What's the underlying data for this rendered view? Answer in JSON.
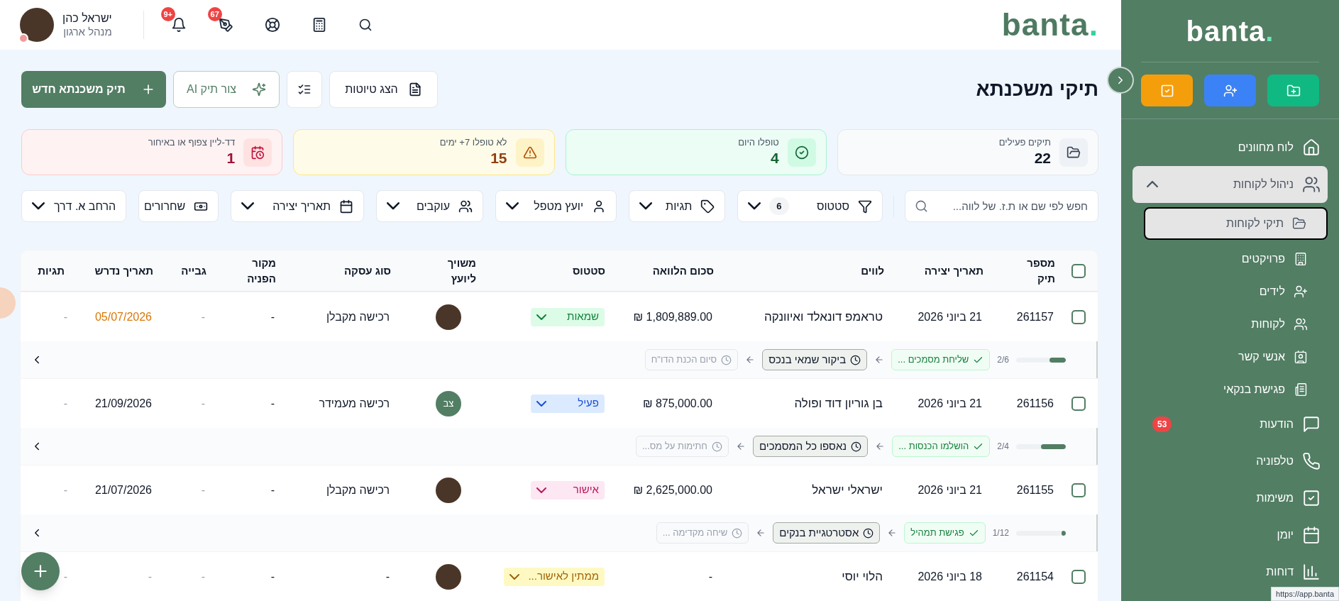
{
  "topbar": {
    "logo": "banta.",
    "notifications_badge": "+9",
    "signatures_badge": "67",
    "user": {
      "name": "ישראל כהן",
      "role": "מנהל ארגון"
    }
  },
  "page": {
    "title": "תיקי משכנתא",
    "drafts_button": "הצג טיוטות",
    "ai_button": "צור תיק AI",
    "new_button": "תיק משכנתא חדש"
  },
  "stats": [
    {
      "label": "תיקים פעילים",
      "value": "22",
      "kind": "neutral"
    },
    {
      "label": "טופלו היום",
      "value": "4",
      "kind": "success"
    },
    {
      "label": "לא טופלו 7+ ימים",
      "value": "15",
      "kind": "warning"
    },
    {
      "label": "דד-ליין צפוף או באיחור",
      "value": "1",
      "kind": "danger"
    }
  ],
  "filters": {
    "search": {
      "placeholder": "חפש לפי שם או ת.ז. של לווה..."
    },
    "chips": [
      {
        "label": "סטטוס",
        "count": "6",
        "kind": "status"
      },
      {
        "label": "תגיות",
        "kind": "tags"
      },
      {
        "label": "יועץ מטפל",
        "kind": "advisor"
      },
      {
        "label": "עוקבים",
        "kind": "followers"
      },
      {
        "label": "תאריך יצירה",
        "kind": "date"
      },
      {
        "label": "שחרורים",
        "kind": "releases"
      },
      {
        "label": "הרחב א. דרך",
        "kind": "expand"
      }
    ]
  },
  "table": {
    "select_all": {
      "checked": false
    },
    "columns": [
      "מספר תיק",
      "תאריך יצירה",
      "לווים",
      "סכום הלוואה",
      "סטטוס",
      "משויך ליועץ",
      "סוג עסקה",
      "מקור הפניה",
      "גבייה",
      "תאריך נדרש",
      "תגיות"
    ],
    "rows": [
      {
        "checked": false,
        "file_number": "261157",
        "created": "21 ביוני 2026",
        "borrower": "טראמפ דונאלד ואיוונקה",
        "amount": "1,809,889.00 ₪",
        "status": {
          "label": "שמאות",
          "kind": "green"
        },
        "advisor": {
          "kind": "photo"
        },
        "deal_type": "רכישה מקבלן",
        "source": "-",
        "collection": "-",
        "required_date": "05/07/2026",
        "overdue": true,
        "tags": "-",
        "pipeline": {
          "level": 0.33,
          "progress": "2/6",
          "steps": [
            {
              "label": "שליחת מסמכים ...",
              "kind": "done"
            },
            {
              "label": "ביקור שמאי בנכס",
              "kind": "current"
            },
            {
              "label": "סיום הכנת הדו\"ח",
              "kind": "next"
            }
          ]
        }
      },
      {
        "checked": false,
        "file_number": "261156",
        "created": "21 ביוני 2026",
        "borrower": "בן גוריון דוד ופולה",
        "amount": "875,000.00 ₪",
        "status": {
          "label": "פעיל",
          "kind": "blue"
        },
        "advisor": {
          "kind": "initials",
          "initials": "צב"
        },
        "deal_type": "רכישה מעמידר",
        "source": "-",
        "collection": "-",
        "required_date": "21/09/2026",
        "overdue": false,
        "tags": "-",
        "pipeline": {
          "level": 0.5,
          "progress": "2/4",
          "steps": [
            {
              "label": "הושלמו הכנסות ...",
              "kind": "done"
            },
            {
              "label": "נאספו כל המסמכים",
              "kind": "current"
            },
            {
              "label": "חתימות על מס...",
              "kind": "next"
            }
          ]
        }
      },
      {
        "checked": false,
        "file_number": "261155",
        "created": "21 ביוני 2026",
        "borrower": "ישראלי ישראל",
        "amount": "2,625,000.00 ₪",
        "status": {
          "label": "אישור",
          "kind": "pink"
        },
        "advisor": {
          "kind": "photo"
        },
        "deal_type": "רכישה מקבלן",
        "source": "-",
        "collection": "-",
        "required_date": "21/07/2026",
        "overdue": false,
        "tags": "-",
        "pipeline": {
          "level": 0.08,
          "progress": "1/12",
          "steps": [
            {
              "label": "פגישת תמהיל",
              "kind": "done"
            },
            {
              "label": "אסטרטגיית בנקים",
              "kind": "current"
            },
            {
              "label": "שיחה מקדימה ...",
              "kind": "next"
            }
          ]
        }
      },
      {
        "checked": false,
        "file_number": "261154",
        "created": "18 ביוני 2026",
        "borrower": "הלוי יוסי",
        "amount": "-",
        "status": {
          "label": "ממתין לאישור...",
          "kind": "yellow"
        },
        "advisor": {
          "kind": "photo"
        },
        "deal_type": "-",
        "source": "-",
        "collection": "-",
        "required_date": "-",
        "overdue": false,
        "tags": "-"
      }
    ]
  },
  "sidebar": {
    "logo": "banta.",
    "nav": [
      {
        "label": "לוח מחוונים",
        "selected": false
      },
      {
        "label": "ניהול לקוחות",
        "selected": false,
        "expanded": true,
        "children": [
          {
            "label": "תיקי לקוחות",
            "selected": true
          },
          {
            "label": "פרויקטים",
            "selected": false
          },
          {
            "label": "לידים",
            "selected": false
          },
          {
            "label": "לקוחות",
            "selected": false
          },
          {
            "label": "אנשי קשר",
            "selected": false
          },
          {
            "label": "פגישת בנקאי",
            "selected": false
          }
        ]
      },
      {
        "label": "הודעות",
        "selected": false,
        "badge": "53"
      },
      {
        "label": "טלפוניה",
        "selected": false
      },
      {
        "label": "משימות",
        "selected": false
      },
      {
        "label": "יומן",
        "selected": false
      },
      {
        "label": "דוחות",
        "selected": false
      }
    ]
  },
  "url_preview": "https://app.banta"
}
